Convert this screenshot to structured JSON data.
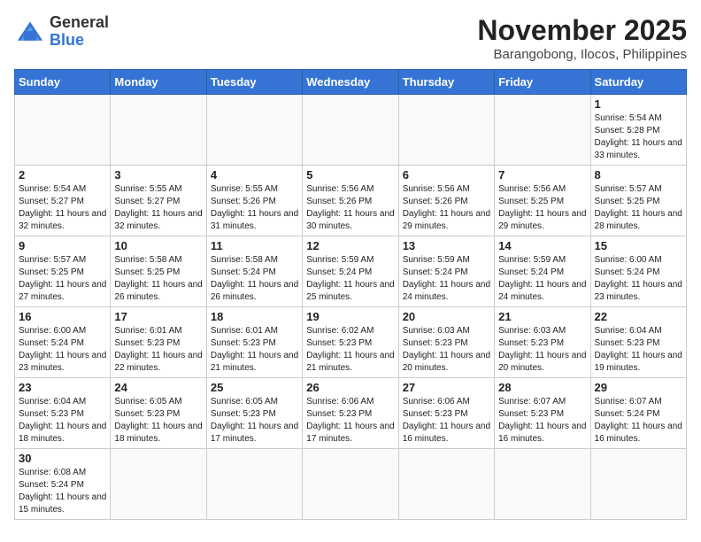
{
  "header": {
    "logo_general": "General",
    "logo_blue": "Blue",
    "month_title": "November 2025",
    "location": "Barangobong, Ilocos, Philippines"
  },
  "weekdays": [
    "Sunday",
    "Monday",
    "Tuesday",
    "Wednesday",
    "Thursday",
    "Friday",
    "Saturday"
  ],
  "days": [
    {
      "date": "",
      "sunrise": "",
      "sunset": "",
      "daylight": ""
    },
    {
      "date": "",
      "sunrise": "",
      "sunset": "",
      "daylight": ""
    },
    {
      "date": "",
      "sunrise": "",
      "sunset": "",
      "daylight": ""
    },
    {
      "date": "",
      "sunrise": "",
      "sunset": "",
      "daylight": ""
    },
    {
      "date": "",
      "sunrise": "",
      "sunset": "",
      "daylight": ""
    },
    {
      "date": "",
      "sunrise": "",
      "sunset": "",
      "daylight": ""
    },
    {
      "date": "1",
      "sunrise": "Sunrise: 5:54 AM",
      "sunset": "Sunset: 5:28 PM",
      "daylight": "Daylight: 11 hours and 33 minutes."
    },
    {
      "date": "2",
      "sunrise": "Sunrise: 5:54 AM",
      "sunset": "Sunset: 5:27 PM",
      "daylight": "Daylight: 11 hours and 32 minutes."
    },
    {
      "date": "3",
      "sunrise": "Sunrise: 5:55 AM",
      "sunset": "Sunset: 5:27 PM",
      "daylight": "Daylight: 11 hours and 32 minutes."
    },
    {
      "date": "4",
      "sunrise": "Sunrise: 5:55 AM",
      "sunset": "Sunset: 5:26 PM",
      "daylight": "Daylight: 11 hours and 31 minutes."
    },
    {
      "date": "5",
      "sunrise": "Sunrise: 5:56 AM",
      "sunset": "Sunset: 5:26 PM",
      "daylight": "Daylight: 11 hours and 30 minutes."
    },
    {
      "date": "6",
      "sunrise": "Sunrise: 5:56 AM",
      "sunset": "Sunset: 5:26 PM",
      "daylight": "Daylight: 11 hours and 29 minutes."
    },
    {
      "date": "7",
      "sunrise": "Sunrise: 5:56 AM",
      "sunset": "Sunset: 5:25 PM",
      "daylight": "Daylight: 11 hours and 29 minutes."
    },
    {
      "date": "8",
      "sunrise": "Sunrise: 5:57 AM",
      "sunset": "Sunset: 5:25 PM",
      "daylight": "Daylight: 11 hours and 28 minutes."
    },
    {
      "date": "9",
      "sunrise": "Sunrise: 5:57 AM",
      "sunset": "Sunset: 5:25 PM",
      "daylight": "Daylight: 11 hours and 27 minutes."
    },
    {
      "date": "10",
      "sunrise": "Sunrise: 5:58 AM",
      "sunset": "Sunset: 5:25 PM",
      "daylight": "Daylight: 11 hours and 26 minutes."
    },
    {
      "date": "11",
      "sunrise": "Sunrise: 5:58 AM",
      "sunset": "Sunset: 5:24 PM",
      "daylight": "Daylight: 11 hours and 26 minutes."
    },
    {
      "date": "12",
      "sunrise": "Sunrise: 5:59 AM",
      "sunset": "Sunset: 5:24 PM",
      "daylight": "Daylight: 11 hours and 25 minutes."
    },
    {
      "date": "13",
      "sunrise": "Sunrise: 5:59 AM",
      "sunset": "Sunset: 5:24 PM",
      "daylight": "Daylight: 11 hours and 24 minutes."
    },
    {
      "date": "14",
      "sunrise": "Sunrise: 5:59 AM",
      "sunset": "Sunset: 5:24 PM",
      "daylight": "Daylight: 11 hours and 24 minutes."
    },
    {
      "date": "15",
      "sunrise": "Sunrise: 6:00 AM",
      "sunset": "Sunset: 5:24 PM",
      "daylight": "Daylight: 11 hours and 23 minutes."
    },
    {
      "date": "16",
      "sunrise": "Sunrise: 6:00 AM",
      "sunset": "Sunset: 5:24 PM",
      "daylight": "Daylight: 11 hours and 23 minutes."
    },
    {
      "date": "17",
      "sunrise": "Sunrise: 6:01 AM",
      "sunset": "Sunset: 5:23 PM",
      "daylight": "Daylight: 11 hours and 22 minutes."
    },
    {
      "date": "18",
      "sunrise": "Sunrise: 6:01 AM",
      "sunset": "Sunset: 5:23 PM",
      "daylight": "Daylight: 11 hours and 21 minutes."
    },
    {
      "date": "19",
      "sunrise": "Sunrise: 6:02 AM",
      "sunset": "Sunset: 5:23 PM",
      "daylight": "Daylight: 11 hours and 21 minutes."
    },
    {
      "date": "20",
      "sunrise": "Sunrise: 6:03 AM",
      "sunset": "Sunset: 5:23 PM",
      "daylight": "Daylight: 11 hours and 20 minutes."
    },
    {
      "date": "21",
      "sunrise": "Sunrise: 6:03 AM",
      "sunset": "Sunset: 5:23 PM",
      "daylight": "Daylight: 11 hours and 20 minutes."
    },
    {
      "date": "22",
      "sunrise": "Sunrise: 6:04 AM",
      "sunset": "Sunset: 5:23 PM",
      "daylight": "Daylight: 11 hours and 19 minutes."
    },
    {
      "date": "23",
      "sunrise": "Sunrise: 6:04 AM",
      "sunset": "Sunset: 5:23 PM",
      "daylight": "Daylight: 11 hours and 18 minutes."
    },
    {
      "date": "24",
      "sunrise": "Sunrise: 6:05 AM",
      "sunset": "Sunset: 5:23 PM",
      "daylight": "Daylight: 11 hours and 18 minutes."
    },
    {
      "date": "25",
      "sunrise": "Sunrise: 6:05 AM",
      "sunset": "Sunset: 5:23 PM",
      "daylight": "Daylight: 11 hours and 17 minutes."
    },
    {
      "date": "26",
      "sunrise": "Sunrise: 6:06 AM",
      "sunset": "Sunset: 5:23 PM",
      "daylight": "Daylight: 11 hours and 17 minutes."
    },
    {
      "date": "27",
      "sunrise": "Sunrise: 6:06 AM",
      "sunset": "Sunset: 5:23 PM",
      "daylight": "Daylight: 11 hours and 16 minutes."
    },
    {
      "date": "28",
      "sunrise": "Sunrise: 6:07 AM",
      "sunset": "Sunset: 5:23 PM",
      "daylight": "Daylight: 11 hours and 16 minutes."
    },
    {
      "date": "29",
      "sunrise": "Sunrise: 6:07 AM",
      "sunset": "Sunset: 5:24 PM",
      "daylight": "Daylight: 11 hours and 16 minutes."
    },
    {
      "date": "30",
      "sunrise": "Sunrise: 6:08 AM",
      "sunset": "Sunset: 5:24 PM",
      "daylight": "Daylight: 11 hours and 15 minutes."
    }
  ]
}
